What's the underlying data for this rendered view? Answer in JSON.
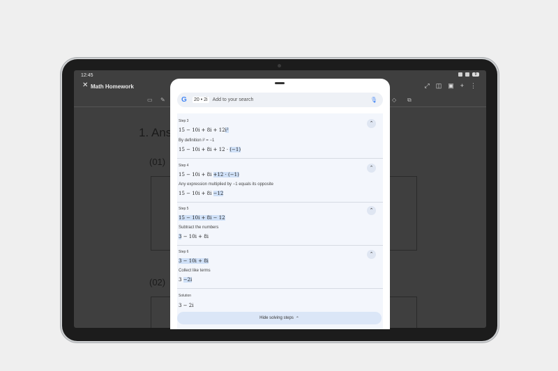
{
  "status_bar": {
    "time": "12:45",
    "battery": "9"
  },
  "app": {
    "title": "Math Homework",
    "close_glyph": "✕"
  },
  "toolbar_right": [
    "⤢",
    "◫",
    "▣",
    "+",
    "⋮"
  ],
  "document": {
    "heading": "1. Answ",
    "sub1": "(01)",
    "sub2": "(02)"
  },
  "search": {
    "logo": "G",
    "chip": "20 • 2i",
    "placeholder": "Add to your search",
    "mic_icon": "mic-icon"
  },
  "steps": [
    {
      "label": "Step 3",
      "line1": [
        {
          "t": "15 − 10"
        },
        {
          "t": "i"
        },
        {
          "t": " + 8"
        },
        {
          "t": "i"
        },
        {
          "t": " + 12"
        },
        {
          "t": "i²",
          "hl": true
        }
      ],
      "explanation": "By definition i² = −1",
      "line2": [
        {
          "t": "15 − 10i + 8i + 12 · "
        },
        {
          "t": "(−1)",
          "hl": true
        }
      ]
    },
    {
      "label": "Step 4",
      "line1": [
        {
          "t": "15 − 10i + 8i "
        },
        {
          "t": "+12 · (−1)",
          "hl": true
        }
      ],
      "explanation": "Any expression multiplied by −1 equals its opposite",
      "line2": [
        {
          "t": "15 − 10i + 8i "
        },
        {
          "t": "−12",
          "hl": true
        }
      ]
    },
    {
      "label": "Step 5",
      "line1": [
        {
          "t": "15 − 10i + 8i − 12",
          "hl": true
        }
      ],
      "explanation": "Subtract the numbers",
      "line2": [
        {
          "t": "3",
          "hl": true
        },
        {
          "t": " − 10i + 8i"
        }
      ]
    },
    {
      "label": "Step 6",
      "line1": [
        {
          "t": "3 − 10i + 8i",
          "hl": true
        }
      ],
      "explanation": "Collect like terms",
      "line2": [
        {
          "t": "3 "
        },
        {
          "t": "−2i",
          "hl": true
        }
      ]
    }
  ],
  "solution": {
    "label": "Solution",
    "value": "3 − 2i"
  },
  "hide_button": {
    "label": "Hide solving steps",
    "icon": "chevron-up-icon"
  }
}
